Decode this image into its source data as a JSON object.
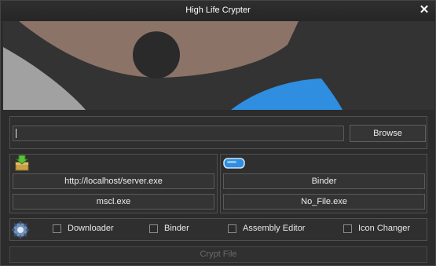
{
  "window": {
    "title": "High Life Crypter",
    "close_glyph": "✕"
  },
  "banner": {
    "shapes": "decorative-art"
  },
  "file": {
    "path_value": "",
    "browse_label": "Browse"
  },
  "downloader": {
    "icon": "package-download-icon",
    "url": "http://localhost/server.exe",
    "file_name": "mscl.exe"
  },
  "binder": {
    "icon": "binder-icon",
    "label": "Binder",
    "file_name": "No_File.exe"
  },
  "options": {
    "icon": "gear-icon",
    "items": [
      {
        "label": "Downloader",
        "checked": false
      },
      {
        "label": "Binder",
        "checked": false
      },
      {
        "label": "Assembly Editor",
        "checked": false
      },
      {
        "label": "Icon Changer",
        "checked": false
      }
    ]
  },
  "action": {
    "crypt_label": "Crypt File"
  },
  "colors": {
    "background": "#2c2c2c",
    "accent_blue": "#2f8ee0",
    "disabled_text": "#6a6a6a"
  }
}
